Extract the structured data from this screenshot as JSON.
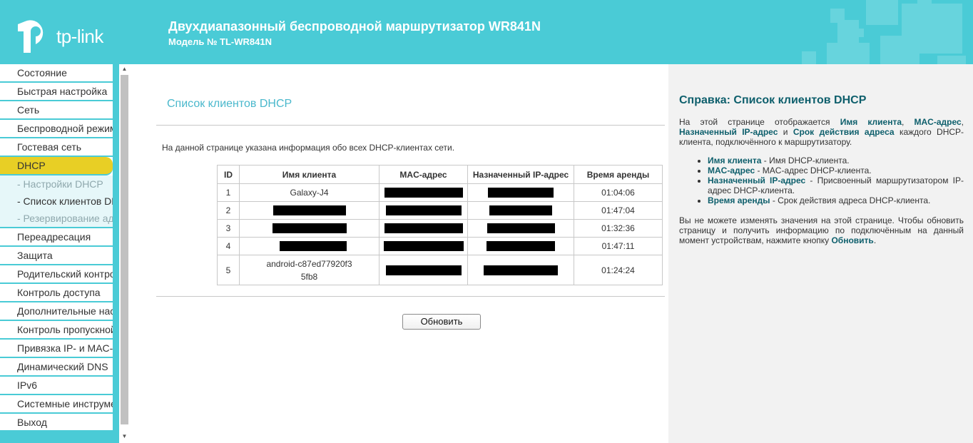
{
  "header": {
    "logo_text": "tp-link",
    "product_title": "Двухдиапазонный беспроводной маршрутизатор WR841N",
    "model_number": "Модель № TL-WR841N"
  },
  "sidebar": {
    "items_top": [
      {
        "label": "Состояние"
      },
      {
        "label": "Быстрая настройка"
      },
      {
        "label": "Сеть"
      },
      {
        "label": "Беспроводной режим"
      },
      {
        "label": "Гостевая сеть"
      }
    ],
    "active_item": {
      "label": "DHCP"
    },
    "submenu": [
      {
        "label": "- Настройки DHCP"
      },
      {
        "label": "- Список клиентов DHCP"
      },
      {
        "label": "- Резервирование адресов"
      }
    ],
    "items_bottom": [
      {
        "label": "Переадресация"
      },
      {
        "label": "Защита"
      },
      {
        "label": "Родительский контроль"
      },
      {
        "label": "Контроль доступа"
      },
      {
        "label": "Дополнительные настройки"
      },
      {
        "label": "Контроль пропускной способности"
      },
      {
        "label": "Привязка IP- и MAC-адресов"
      },
      {
        "label": "Динамический DNS"
      },
      {
        "label": "IPv6"
      },
      {
        "label": "Системные инструменты"
      },
      {
        "label": "Выход"
      }
    ]
  },
  "main": {
    "page_title": "Список клиентов DHCP",
    "description": "На данной странице указана информация обо всех DHCP-клиентах сети.",
    "table": {
      "headers": [
        "ID",
        "Имя клиента",
        "MAC-адрес",
        "Назначенный IP-адрес",
        "Время аренды"
      ],
      "rows": [
        {
          "id": "1",
          "name": "Galaxy-J4",
          "name_redacted": false,
          "lease": "01:04:06"
        },
        {
          "id": "2",
          "name": "",
          "name_redacted": true,
          "lease": "01:47:04"
        },
        {
          "id": "3",
          "name": "",
          "name_redacted": true,
          "lease": "01:32:36"
        },
        {
          "id": "4",
          "name": "",
          "name_redacted": true,
          "lease": "01:47:11"
        },
        {
          "id": "5",
          "name_line1": "android-c87ed77920f3",
          "name_line2": "5fb8",
          "name_redacted": false,
          "lease": "01:24:24"
        }
      ]
    },
    "refresh_label": "Обновить"
  },
  "help": {
    "title": "Справка: Список клиентов DHCP",
    "intro_1": "На этой странице отображается ",
    "k_name": "Имя клиента",
    "sep_1": ", ",
    "k_mac": "MAC-адрес",
    "sep_2": ", ",
    "k_ip": "Назначенный IP-адрес",
    "sep_3": " и ",
    "k_lease": "Срок действия адреса",
    "intro_2": " каждого DHCP-клиента, подключённого к маршрутизатору.",
    "bullets": [
      {
        "key": "Имя клиента",
        "text": " - Имя DHCP-клиента."
      },
      {
        "key": "MAC-адрес",
        "text": " - MAC-адрес DHCP-клиента."
      },
      {
        "key": "Назначенный IP-адрес",
        "text": " - Присвоенный маршрутизатором IP-адрес DHCP-клиента."
      },
      {
        "key": "Время аренды",
        "text": " - Срок действия адреса DHCP-клиента."
      }
    ],
    "outro_1": "Вы не можете изменять значения на этой странице. Чтобы обновить страницу и получить информацию по подключённым на данный момент устройствам, нажмите кнопку ",
    "outro_key": "Обновить",
    "outro_2": "."
  },
  "colors": {
    "header_bg": "#4acbd6",
    "active_menu": "#e8cf25",
    "help_title": "#0e5f6c"
  }
}
